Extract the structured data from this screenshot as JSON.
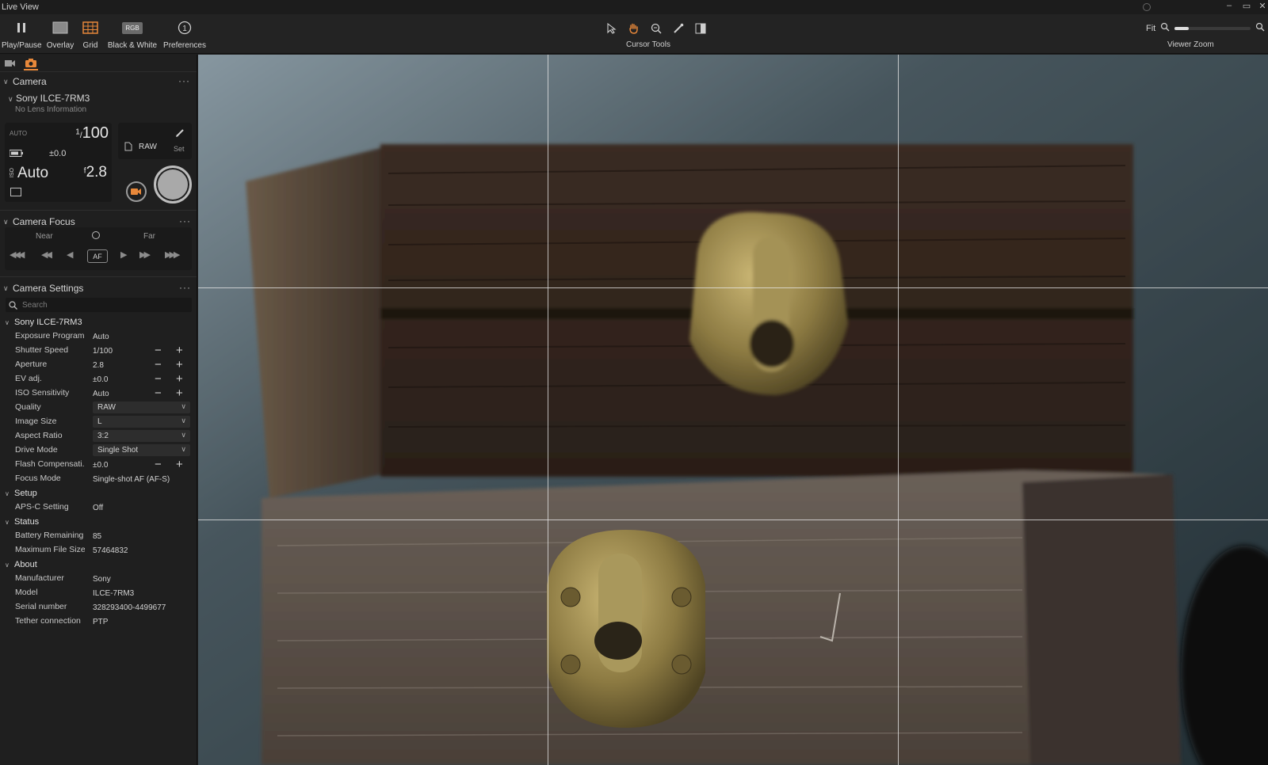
{
  "window": {
    "title": "Live View"
  },
  "toolbar": {
    "play_pause": "Play/Pause",
    "overlay": "Overlay",
    "grid": "Grid",
    "bw": "Black & White",
    "bw_badge": "RGB",
    "preferences": "Preferences",
    "cursor_tools": "Cursor Tools",
    "viewer_zoom": "Viewer Zoom",
    "zoom_fit": "Fit",
    "zoom_level_fraction": 0.18
  },
  "camera": {
    "header": "Camera",
    "model": "Sony ILCE-7RM3",
    "lens": "No Lens Information",
    "mode": "AUTO",
    "shutter_num": "1",
    "shutter_den": "100",
    "ev": "±0.0",
    "iso_label": "ISO",
    "iso": "Auto",
    "aperture_prefix": "f",
    "aperture": "2.8",
    "quality": "RAW",
    "set": "Set"
  },
  "focus": {
    "header": "Camera Focus",
    "near": "Near",
    "far": "Far",
    "af": "AF"
  },
  "settings": {
    "header": "Camera Settings",
    "search_placeholder": "Search",
    "group_device": "Sony ILCE-7RM3",
    "rows": [
      {
        "label": "Exposure Program",
        "value": "Auto"
      },
      {
        "label": "Shutter Speed",
        "value": "1/100"
      },
      {
        "label": "Aperture",
        "value": "2.8"
      },
      {
        "label": "EV adj.",
        "value": "±0.0"
      },
      {
        "label": "ISO Sensitivity",
        "value": "Auto"
      },
      {
        "label": "Quality",
        "value": "RAW"
      },
      {
        "label": "Image Size",
        "value": "L"
      },
      {
        "label": "Aspect Ratio",
        "value": "3:2"
      },
      {
        "label": "Drive Mode",
        "value": "Single Shot"
      },
      {
        "label": "Flash Compensati...",
        "value": "±0.0"
      },
      {
        "label": "Focus Mode",
        "value": "Single-shot AF (AF-S)"
      }
    ],
    "group_setup": "Setup",
    "setup_rows": [
      {
        "label": "APS-C Setting",
        "value": "Off"
      }
    ],
    "group_status": "Status",
    "status_rows": [
      {
        "label": "Battery Remaining",
        "value": "85"
      },
      {
        "label": "Maximum File Size",
        "value": "57464832"
      }
    ],
    "group_about": "About",
    "about_rows": [
      {
        "label": "Manufacturer",
        "value": "Sony"
      },
      {
        "label": "Model",
        "value": "ILCE-7RM3"
      },
      {
        "label": "Serial number",
        "value": "328293400-4499677"
      },
      {
        "label": "Tether connection",
        "value": "PTP"
      }
    ]
  },
  "colors": {
    "accent": "#e8883a",
    "panel": "#1f1f1f",
    "toolbar": "#232323"
  }
}
